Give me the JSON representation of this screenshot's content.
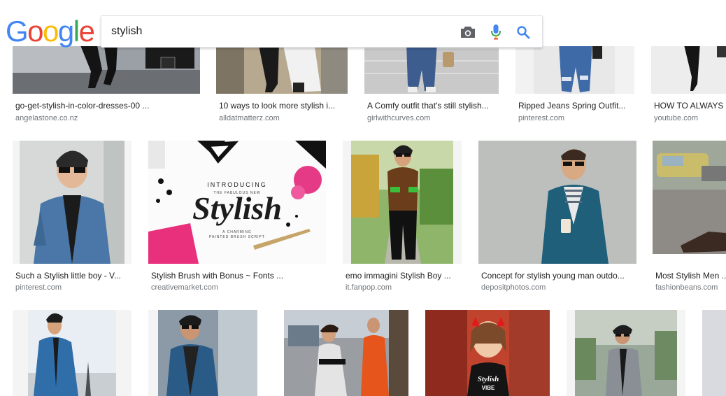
{
  "search": {
    "query": "stylish"
  },
  "logo": {
    "letters": [
      "G",
      "o",
      "o",
      "g",
      "l",
      "e"
    ]
  },
  "icons": {
    "camera": "camera-icon",
    "mic": "microphone-icon",
    "search": "search-icon"
  },
  "colors": {
    "google_blue": "#4285f4",
    "google_red": "#ea4335",
    "google_yellow": "#fbbc05",
    "google_green": "#34a853",
    "caption_text": "#222222",
    "source_text": "#70757a"
  },
  "results": {
    "row1": [
      {
        "title": "go-get-stylish-in-color-dresses-00 ...",
        "source": "angelastone.co.nz"
      },
      {
        "title": "10 ways to look more stylish i...",
        "source": "alldatmatterz.com"
      },
      {
        "title": "A Comfy outfit that's still stylish...",
        "source": "girlwithcurves.com"
      },
      {
        "title": "Ripped Jeans Spring Outfit...",
        "source": "pinterest.com"
      },
      {
        "title": "HOW TO ALWAYS",
        "source": "youtube.com"
      }
    ],
    "row2": [
      {
        "title": "Such a Stylish little boy - V...",
        "source": "pinterest.com"
      },
      {
        "title": "Stylish Brush with Bonus ~ Fonts ...",
        "source": "creativemarket.com"
      },
      {
        "title": "emo immagini Stylish Boy ...",
        "source": "it.fanpop.com"
      },
      {
        "title": "Concept for stylish young man outdo...",
        "source": "depositphotos.com"
      },
      {
        "title": "Most Stylish Men ...",
        "source": "fashionbeans.com"
      }
    ]
  },
  "image_text": {
    "brush_introducing": "INTRODUCING",
    "brush_subtitle": "THE FABULOUS NEW",
    "brush_word": "Stylish",
    "brush_line1": "A CHARMING",
    "brush_line2": "PAINTED BRUSH SCRIPT",
    "shirt_line1": "Stylish",
    "shirt_line2": "VIBE"
  }
}
